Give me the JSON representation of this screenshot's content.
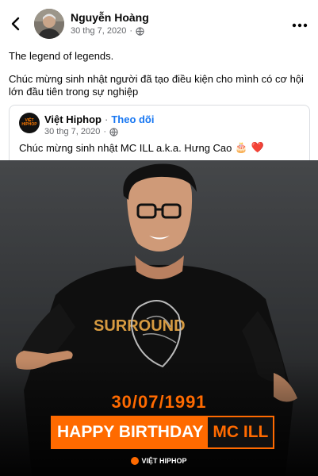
{
  "post": {
    "author_name": "Nguyễn Hoàng",
    "timestamp": "30 thg 7, 2020",
    "separator": "·",
    "text_line1": "The legend of legends.",
    "text_line2": "Chúc mừng sinh nhật người đã tạo điều kiện cho mình có cơ hội lớn đầu tiên trong sự nghiệp"
  },
  "shared": {
    "page_name": "Việt Hiphop",
    "dot": "·",
    "follow_label": "Theo dõi",
    "timestamp": "30 thg 7, 2020",
    "separator": "·",
    "logo_text": "VIỆT HIPHOP",
    "text": "Chúc mừng sinh nhật MC ILL a.k.a. Hưng Cao",
    "emoji_cake": "🎂",
    "emoji_heart": "❤️"
  },
  "photo": {
    "date": "30/07/1991",
    "banner_main": "HAPPY BIRTHDAY",
    "banner_name": "MC ILL",
    "footer_brand": "VIỆT HIPHOP",
    "shirt_text": "SURROUND"
  },
  "icons": {
    "back": "chevron-left-icon",
    "more": "more-horizontal-icon",
    "privacy": "globe-icon"
  },
  "colors": {
    "accent_orange": "#ff6a00",
    "link_blue": "#1877f2",
    "meta_gray": "#65676b"
  }
}
